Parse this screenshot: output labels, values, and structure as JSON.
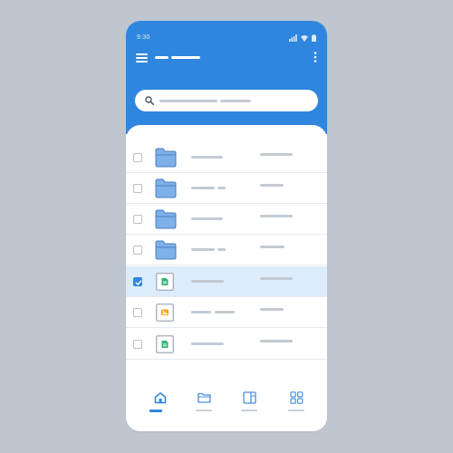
{
  "status_bar": {
    "time": "9:30"
  },
  "search": {
    "placeholder": ""
  },
  "files": [
    {
      "type": "folder",
      "checked": false,
      "selected": false
    },
    {
      "type": "folder",
      "checked": false,
      "selected": false
    },
    {
      "type": "folder",
      "checked": false,
      "selected": false
    },
    {
      "type": "folder",
      "checked": false,
      "selected": false
    },
    {
      "type": "document",
      "color": "#2bb673",
      "checked": true,
      "selected": true
    },
    {
      "type": "image",
      "color": "#f5a623",
      "checked": false,
      "selected": false
    },
    {
      "type": "document",
      "color": "#2bb673",
      "checked": false,
      "selected": false
    }
  ],
  "bottom_nav": [
    {
      "icon": "home-icon",
      "active": true
    },
    {
      "icon": "folder-icon",
      "active": false
    },
    {
      "icon": "panel-icon",
      "active": false
    },
    {
      "icon": "grid-icon",
      "active": false
    }
  ],
  "colors": {
    "accent": "#2f86de",
    "background": "#bfc6d0",
    "folder": "#7fb0e8",
    "selected_row": "#dcecfb"
  }
}
